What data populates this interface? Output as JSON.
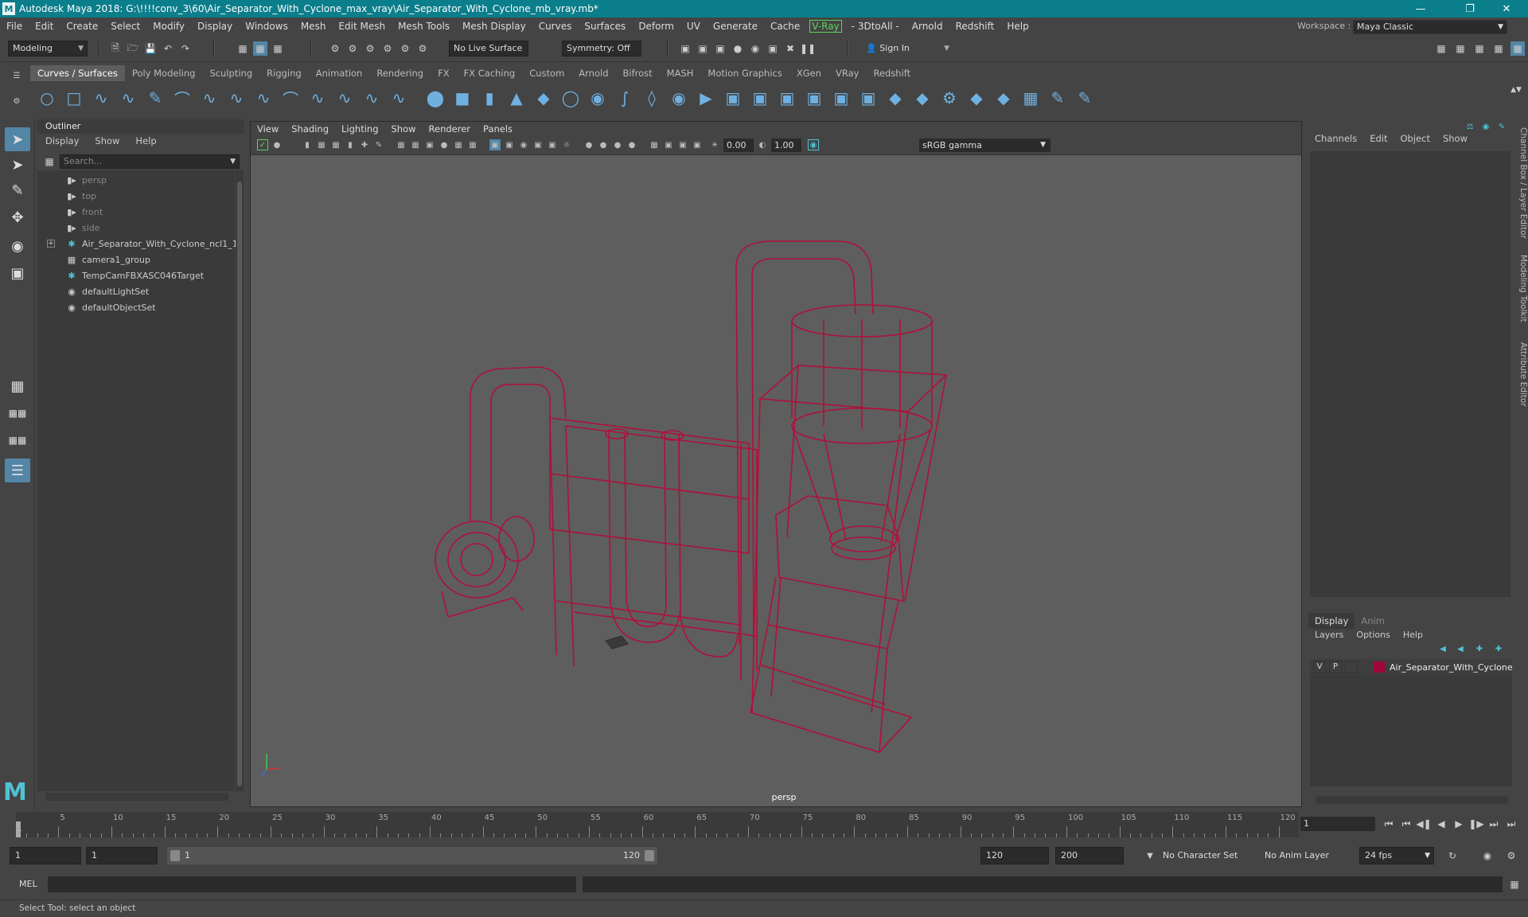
{
  "window": {
    "title": "Autodesk Maya 2018: G:\\!!!!conv_3\\60\\Air_Separator_With_Cyclone_max_vray\\Air_Separator_With_Cyclone_mb_vray.mb*",
    "logo_letter": "M"
  },
  "menu": [
    "File",
    "Edit",
    "Create",
    "Select",
    "Modify",
    "Display",
    "Windows",
    "Mesh",
    "Edit Mesh",
    "Mesh Tools",
    "Mesh Display",
    "Curves",
    "Surfaces",
    "Deform",
    "UV",
    "Generate",
    "Cache"
  ],
  "menu_vray": "V-Ray",
  "menu2": [
    "- 3DtoAll -",
    "Arnold",
    "Redshift",
    "Help"
  ],
  "workspace": {
    "label": "Workspace :",
    "value": "Maya Classic"
  },
  "status": {
    "mode": "Modeling",
    "live_surface": "No Live Surface",
    "symmetry": "Symmetry: Off",
    "sign_in": "Sign In"
  },
  "shelf_tabs": [
    "Curves / Surfaces",
    "Poly Modeling",
    "Sculpting",
    "Rigging",
    "Animation",
    "Rendering",
    "FX",
    "FX Caching",
    "Custom",
    "Arnold",
    "Bifrost",
    "MASH",
    "Motion Graphics",
    "XGen",
    "VRay",
    "Redshift"
  ],
  "outliner": {
    "title": "Outliner",
    "menu": [
      "Display",
      "Show",
      "Help"
    ],
    "search_placeholder": "Search...",
    "items": [
      {
        "label": "persp",
        "icon": "camera-icon"
      },
      {
        "label": "top",
        "icon": "camera-icon"
      },
      {
        "label": "front",
        "icon": "camera-icon"
      },
      {
        "label": "side",
        "icon": "camera-icon"
      },
      {
        "label": "Air_Separator_With_Cyclone_ncl1_1",
        "icon": "transform-icon"
      },
      {
        "label": "camera1_group",
        "icon": "group-icon"
      },
      {
        "label": "TempCamFBXASC046Target",
        "icon": "transform-icon"
      },
      {
        "label": "defaultLightSet",
        "icon": "set-icon"
      },
      {
        "label": "defaultObjectSet",
        "icon": "set-icon"
      }
    ]
  },
  "viewport": {
    "menu": [
      "View",
      "Shading",
      "Lighting",
      "Show",
      "Renderer",
      "Panels"
    ],
    "exposure": "0.00",
    "gamma": "1.00",
    "color_space": "sRGB gamma",
    "camera_label": "persp",
    "wire_color": "#b0103c"
  },
  "channel_box": {
    "menu": [
      "Channels",
      "Edit",
      "Object",
      "Show"
    ]
  },
  "side_tabs": [
    "Channel Box / Layer Editor",
    "Modeling Toolkit",
    "Attribute Editor"
  ],
  "layer_editor": {
    "tabs": [
      "Display",
      "Anim"
    ],
    "menu": [
      "Layers",
      "Options",
      "Help"
    ],
    "layer": {
      "v": "V",
      "p": "P",
      "name": "Air_Separator_With_Cyclone",
      "color": "#a0063a"
    }
  },
  "timeline": {
    "ticks": [
      "5",
      "10",
      "15",
      "20",
      "25",
      "30",
      "35",
      "40",
      "45",
      "50",
      "55",
      "60",
      "65",
      "70",
      "75",
      "80",
      "85",
      "90",
      "95",
      "100",
      "105",
      "110",
      "115",
      "120"
    ],
    "start_tick": "1",
    "current_frame": "1"
  },
  "range": {
    "start": "1",
    "playback_start": "1",
    "slider_start": "1",
    "slider_end": "120",
    "playback_end": "120",
    "end": "200",
    "character_set": "No Character Set",
    "anim_layer": "No Anim Layer",
    "fps": "24 fps"
  },
  "command": {
    "label": "MEL"
  },
  "help_line": "Select Tool: select an object"
}
